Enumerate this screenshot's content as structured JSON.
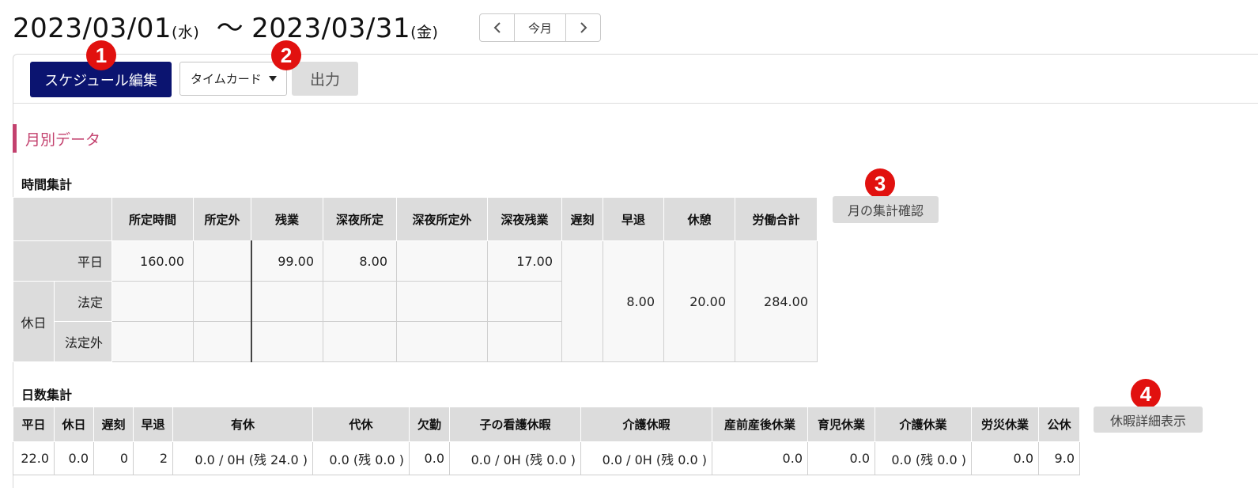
{
  "header": {
    "start_date": "2023/03/01",
    "start_dow": "(水)",
    "separator": "〜",
    "end_date": "2023/03/31",
    "end_dow": "(金)",
    "nav": {
      "prev_icon": "chevron-left-icon",
      "current_label": "今月",
      "next_icon": "chevron-right-icon"
    }
  },
  "toolbar": {
    "schedule_edit_label": "スケジュール編集",
    "report_select_value": "タイムカード",
    "output_label": "出力"
  },
  "badges": [
    "1",
    "2",
    "3",
    "4"
  ],
  "section": {
    "title": "月別データ"
  },
  "time_summary": {
    "title": "時間集計",
    "confirm_button": "月の集計確認",
    "headers": [
      "所定時間",
      "所定外",
      "残業",
      "深夜所定",
      "深夜所定外",
      "深夜残業",
      "遅刻",
      "早退",
      "休憩",
      "労働合計"
    ],
    "row_labels": {
      "weekday": "平日",
      "holiday": "休日",
      "legal": "法定",
      "non_legal": "法定外"
    },
    "weekday": [
      "160.00",
      "",
      "99.00",
      "8.00",
      "",
      "17.00"
    ],
    "legal": [
      "",
      "",
      "",
      "",
      "",
      ""
    ],
    "non_legal": [
      "",
      "",
      "",
      "",
      "",
      ""
    ],
    "totals": {
      "late": "",
      "early_leave": "8.00",
      "break": "20.00",
      "work_total": "284.00"
    }
  },
  "day_summary": {
    "title": "日数集計",
    "detail_button": "休暇詳細表示",
    "headers": [
      "平日",
      "休日",
      "遅刻",
      "早退",
      "有休",
      "代休",
      "欠勤",
      "子の看護休暇",
      "介護休暇",
      "産前産後休業",
      "育児休業",
      "介護休業",
      "労災休業",
      "公休"
    ],
    "values": [
      "22.0",
      "0.0",
      "0",
      "2",
      "0.0 / 0H (残 24.0 )",
      "0.0 (残 0.0 )",
      "0.0",
      "0.0 / 0H (残 0.0 )",
      "0.0 / 0H (残 0.0 )",
      "0.0",
      "0.0",
      "0.0 (残 0.0 )",
      "0.0",
      "9.0"
    ]
  },
  "colors": {
    "primary": "#0b1470",
    "accent": "#c3416e",
    "badge": "#e1110f",
    "header_bg": "#dcdcdc"
  }
}
